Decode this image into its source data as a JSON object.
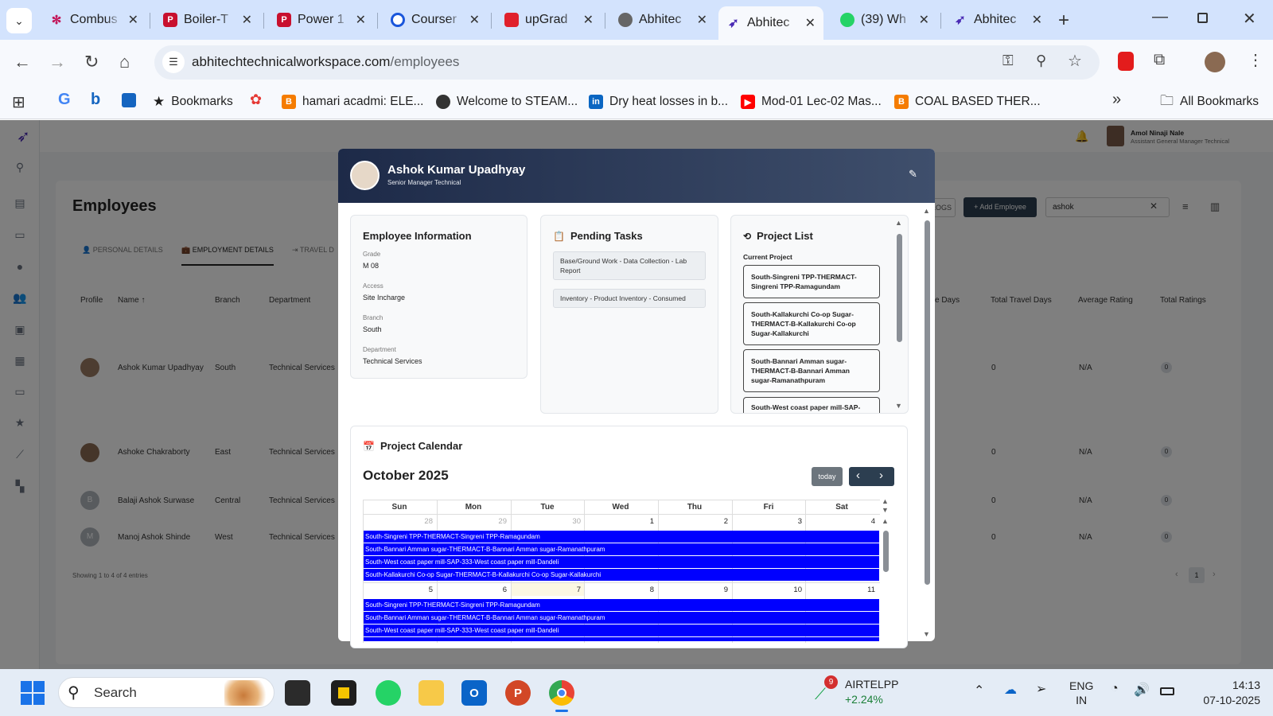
{
  "browser": {
    "tabs": [
      {
        "label": "Combus",
        "icon": "cluster-icon"
      },
      {
        "label": "Boiler-T",
        "icon": "p-icon"
      },
      {
        "label": "Power 1",
        "icon": "p-icon"
      },
      {
        "label": "Courser",
        "icon": "c-icon"
      },
      {
        "label": "upGrad",
        "icon": "upgrad-icon"
      },
      {
        "label": "Abhitec",
        "icon": "globe-icon"
      },
      {
        "label": "Abhitec",
        "icon": "feather-icon"
      },
      {
        "label": "(39) Wh",
        "icon": "whatsapp-icon"
      },
      {
        "label": "Abhitec",
        "icon": "feather-icon"
      }
    ],
    "url_host": "abhitechtechnicalworkspace.com",
    "url_path": "/employees",
    "bookmarks": [
      {
        "label": "Bookmarks"
      },
      {
        "label": "hamari acadmi: ELE..."
      },
      {
        "label": "Welcome to STEAM..."
      },
      {
        "label": "Dry heat losses in b..."
      },
      {
        "label": "Mod-01 Lec-02 Mas..."
      },
      {
        "label": "COAL BASED THER..."
      }
    ],
    "all_bookmarks": "All Bookmarks"
  },
  "app": {
    "user_name": "Amol Ninaji Nale",
    "user_role": "Assistant General Manager Technical",
    "page_title": "Employees",
    "tabs": [
      "PERSONAL DETAILS",
      "EMPLOYMENT DETAILS",
      "TRAVEL D"
    ],
    "logs_label": "LOGS",
    "add_employee": "+ Add Employee",
    "search_value": "ashok",
    "columns": [
      "Profile",
      "Name ↑",
      "Branch",
      "Department",
      "e Days",
      "Total Travel Days",
      "Average Rating",
      "Total Ratings"
    ],
    "rows": [
      {
        "initial": "",
        "name": "Ashok Kumar Upadhyay",
        "branch": "South",
        "dept": "Technical Services",
        "days": "0",
        "rating": "N/A",
        "total": "0"
      },
      {
        "initial": "",
        "name": "Ashoke Chakraborty",
        "branch": "East",
        "dept": "Technical Services",
        "days": "0",
        "rating": "N/A",
        "total": "0"
      },
      {
        "initial": "B",
        "name": "Balaji Ashok Surwase",
        "branch": "Central",
        "dept": "Technical Services",
        "days": "0",
        "rating": "N/A",
        "total": "0"
      },
      {
        "initial": "M",
        "name": "Manoj Ashok Shinde",
        "branch": "West",
        "dept": "Technical Services",
        "days": "0",
        "rating": "N/A",
        "total": "0"
      }
    ],
    "showing": "Showing 1 to 4 of 4 entries",
    "page": "1"
  },
  "modal": {
    "name": "Ashok Kumar Upadhyay",
    "role": "Senior Manager Technical",
    "info_title": "Employee Information",
    "info": [
      {
        "label": "Grade",
        "value": "M 08"
      },
      {
        "label": "Access",
        "value": "Site Incharge"
      },
      {
        "label": "Branch",
        "value": "South"
      },
      {
        "label": "Department",
        "value": "Technical Services"
      }
    ],
    "tasks_title": "Pending Tasks",
    "tasks": [
      "Base/Ground Work - Data Collection - Lab Report",
      "Inventory - Product Inventory - Consumed"
    ],
    "projects_title": "Project List",
    "current_project": "Current Project",
    "projects": [
      "South-Singreni TPP-THERMACT-Singreni TPP-Ramagundam",
      "South-Kallakurchi Co-op Sugar-THERMACT-B-Kallakurchi Co-op Sugar-Kallakurchi",
      "South-Bannari Amman sugar-THERMACT-B-Bannari Amman sugar-Ramanathpuram",
      "South-West coast paper mill-SAP-"
    ],
    "calendar_title": "Project Calendar",
    "month": "October 2025",
    "today": "today",
    "weekdays": [
      "Sun",
      "Mon",
      "Tue",
      "Wed",
      "Thu",
      "Fri",
      "Sat"
    ],
    "week1": [
      "28",
      "29",
      "30",
      "1",
      "2",
      "3",
      "4"
    ],
    "week2": [
      "5",
      "6",
      "7",
      "8",
      "9",
      "10",
      "11"
    ],
    "week1_events": [
      "South-Singreni TPP-THERMACT-Singreni TPP-Ramagundam",
      "South-Bannari Amman sugar-THERMACT-B-Bannari Amman sugar-Ramanathpuram",
      "South-West coast paper mill-SAP-333-West coast paper mill-Dandeli",
      "South-Kallakurchi Co-op Sugar-THERMACT-B-Kallakurchi Co-op Sugar-Kallakurchi"
    ],
    "week2_events": [
      "South-Singreni TPP-THERMACT-Singreni TPP-Ramagundam",
      "South-Bannari Amman sugar-THERMACT-B-Bannari Amman sugar-Ramanathpuram",
      "South-West coast paper mill-SAP-333-West coast paper mill-Dandeli"
    ],
    "event_color": "#0000ff"
  },
  "taskbar": {
    "search": "Search",
    "stock_name": "AIRTELPP",
    "stock_change": "+2.24%",
    "stock_badge": "9",
    "lang1": "ENG",
    "lang2": "IN",
    "time": "14:13",
    "date": "07-10-2025"
  }
}
